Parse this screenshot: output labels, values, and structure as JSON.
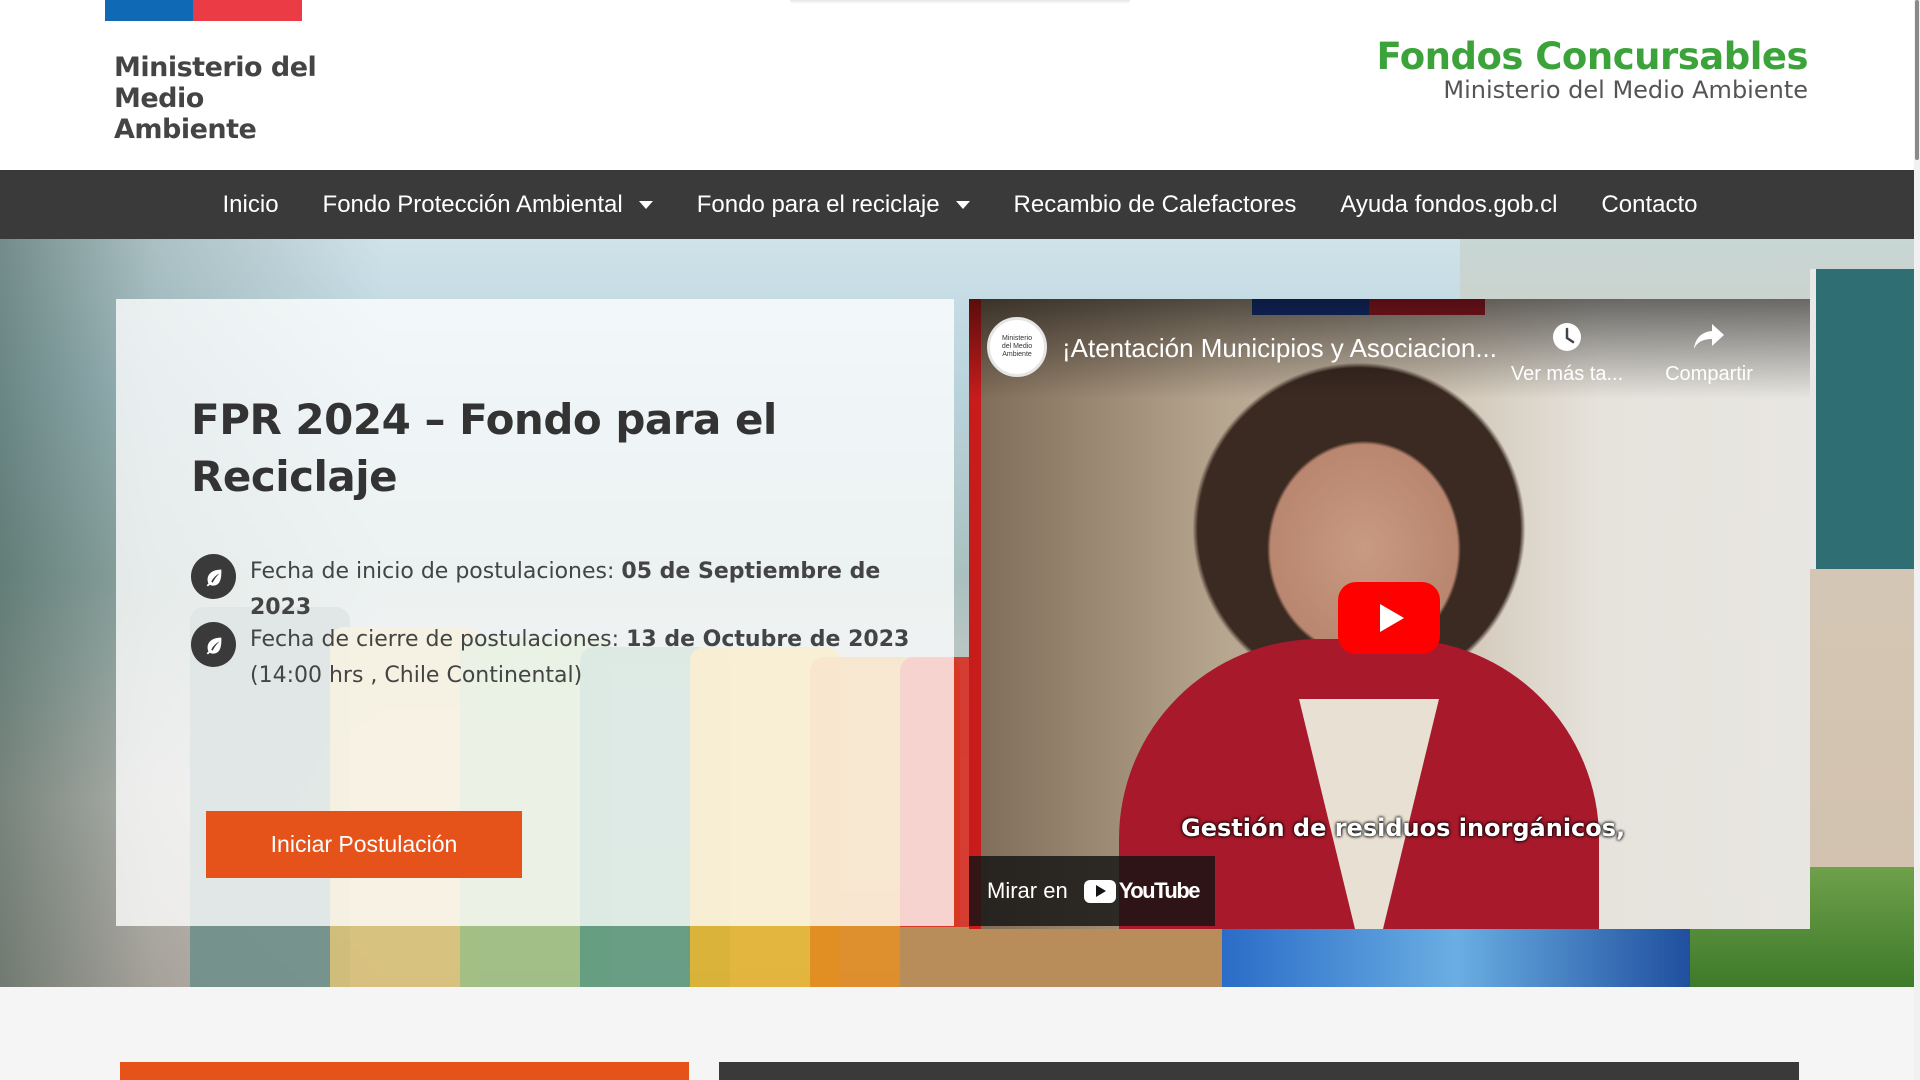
{
  "header": {
    "ministry_logo_text": "Ministerio del Medio Ambiente",
    "brand_title": "Fondos Concursables",
    "brand_subtitle": "Ministerio del Medio Ambiente",
    "flag_colors": {
      "blue": "#0f69b4",
      "red": "#eb3c46"
    }
  },
  "nav": {
    "items": [
      {
        "label": "Inicio",
        "has_dropdown": false
      },
      {
        "label": "Fondo Protección Ambiental",
        "has_dropdown": true
      },
      {
        "label": "Fondo para el reciclaje",
        "has_dropdown": true
      },
      {
        "label": "Recambio de Calefactores",
        "has_dropdown": false
      },
      {
        "label": "Ayuda fondos.gob.cl",
        "has_dropdown": false
      },
      {
        "label": "Contacto",
        "has_dropdown": false
      }
    ]
  },
  "hero": {
    "title": "FPR 2024 – Fondo para el Reciclaje",
    "start_label": "Fecha de inicio de postulaciones:",
    "start_value": "05 de Septiembre de 2023",
    "end_label": "Fecha de cierre de postulaciones:",
    "end_value": "13 de Octubre de 2023",
    "end_note": "(14:00 hrs , Chile Continental)",
    "cta_label": "Iniciar Postulación",
    "date_icon": "leaf-icon",
    "accent_color": "#e5531a"
  },
  "video": {
    "title": "¡Atentación Municipios y Asociacion...",
    "channel_avatar_text": "Ministerio del Medio Ambiente",
    "watch_later_label": "Ver más ta...",
    "share_label": "Compartir",
    "caption": "Gestión de residuos inorgánicos,",
    "watch_on_label": "Mirar en",
    "youtube_wordmark": "YouTube",
    "play_color": "#ff0000"
  },
  "theme": {
    "nav_bg": "#3a3a3a",
    "brand_green": "#3ca33a"
  }
}
